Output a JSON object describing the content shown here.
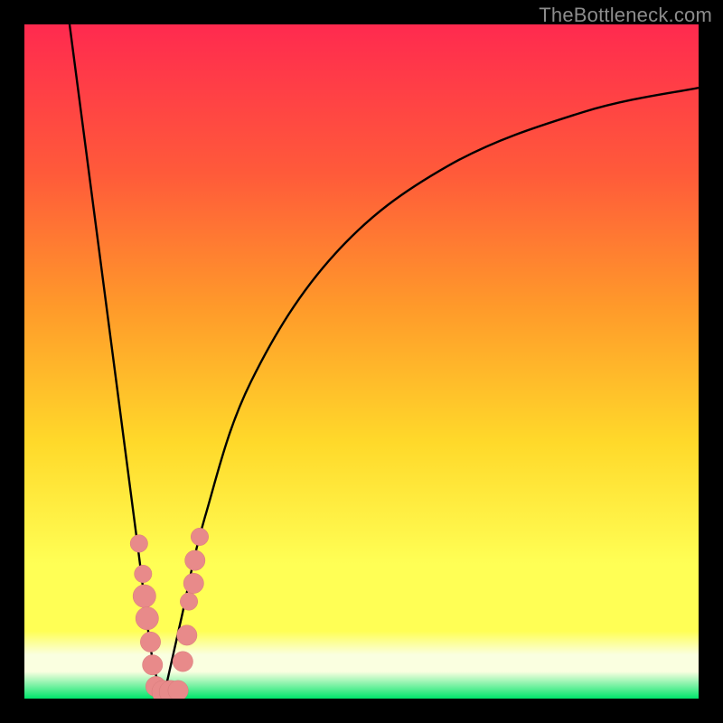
{
  "watermark": "TheBottleneck.com",
  "colors": {
    "frame": "#000000",
    "gradient_top": "#ff2a4f",
    "gradient_mid1": "#ff5a3a",
    "gradient_mid2": "#ff9a2a",
    "gradient_mid3": "#ffd92a",
    "gradient_mid4": "#ffff55",
    "gradient_band": "#faffe0",
    "gradient_bottom": "#00e56b",
    "curve": "#000000",
    "marker_fill": "#e88a8a",
    "marker_stroke": "#d77a7a"
  },
  "chart_data": {
    "type": "line",
    "title": "",
    "xlabel": "",
    "ylabel": "",
    "xlim": [
      0,
      100
    ],
    "ylim": [
      0,
      100
    ],
    "grid": false,
    "legend": false,
    "series": [
      {
        "name": "left-branch",
        "x": [
          6.7,
          16.5,
          18.8,
          20.6
        ],
        "y": [
          100,
          25,
          7,
          0
        ]
      },
      {
        "name": "right-branch",
        "x": [
          20.6,
          23.3,
          26.8,
          33.6,
          46.1,
          62.8,
          82.9,
          100
        ],
        "y": [
          0,
          12,
          27,
          47,
          66,
          79,
          87,
          90.6
        ]
      }
    ],
    "markers": {
      "name": "data-points",
      "points": [
        {
          "x": 17.0,
          "y": 23.0,
          "r": 1.3
        },
        {
          "x": 17.6,
          "y": 18.5,
          "r": 1.3
        },
        {
          "x": 17.8,
          "y": 15.2,
          "r": 1.7
        },
        {
          "x": 18.2,
          "y": 11.9,
          "r": 1.7
        },
        {
          "x": 18.7,
          "y": 8.4,
          "r": 1.5
        },
        {
          "x": 19.0,
          "y": 5.0,
          "r": 1.5
        },
        {
          "x": 19.5,
          "y": 1.8,
          "r": 1.5
        },
        {
          "x": 20.6,
          "y": 1.0,
          "r": 1.7
        },
        {
          "x": 21.7,
          "y": 1.0,
          "r": 1.7
        },
        {
          "x": 22.8,
          "y": 1.2,
          "r": 1.5
        },
        {
          "x": 23.5,
          "y": 5.5,
          "r": 1.5
        },
        {
          "x": 24.1,
          "y": 9.4,
          "r": 1.5
        },
        {
          "x": 24.4,
          "y": 14.4,
          "r": 1.3
        },
        {
          "x": 25.1,
          "y": 17.1,
          "r": 1.5
        },
        {
          "x": 25.3,
          "y": 20.5,
          "r": 1.5
        },
        {
          "x": 26.0,
          "y": 24.0,
          "r": 1.3
        }
      ]
    }
  }
}
